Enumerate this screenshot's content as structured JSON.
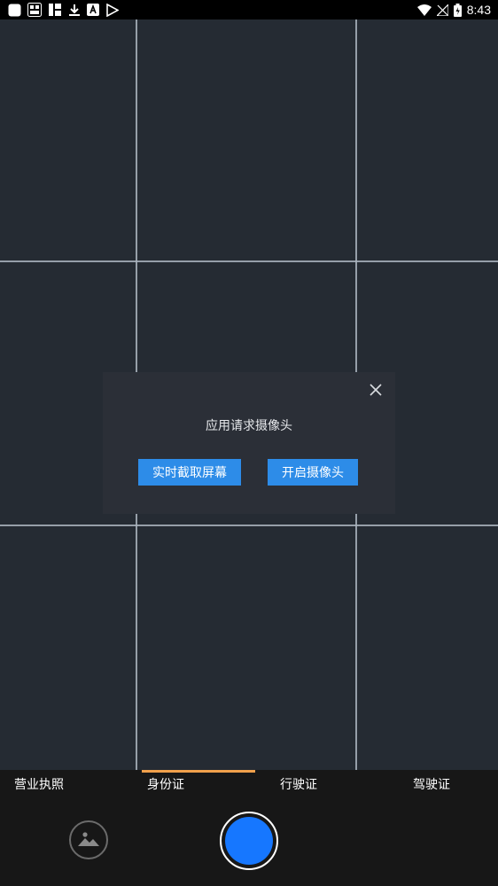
{
  "status_bar": {
    "left_icons": [
      "app-icon",
      "news-app-icon",
      "bao-app-icon",
      "download-icon",
      "a-app-icon",
      "play-store-icon"
    ],
    "right_icons": [
      "wifi-icon",
      "signal-icon",
      "battery-charging-icon"
    ],
    "time": "8:43"
  },
  "dialog": {
    "message": "应用请求摄像头",
    "screen_capture_label": "实时截取屏幕",
    "open_camera_label": "开启摄像头"
  },
  "tabs": [
    {
      "label": "营业执照",
      "active": false
    },
    {
      "label": "身份证",
      "active": true
    },
    {
      "label": "行驶证",
      "active": false
    },
    {
      "label": "驾驶证",
      "active": false
    }
  ],
  "colors": {
    "viewfinder_bg": "#252b33",
    "grid_line": "#aab4be",
    "dialog_bg": "#2b2f37",
    "button_blue": "#2d8ce8",
    "tab_indicator": "#f0a04b",
    "shutter_fill": "#1677ff",
    "bottom_bar": "#171717"
  }
}
